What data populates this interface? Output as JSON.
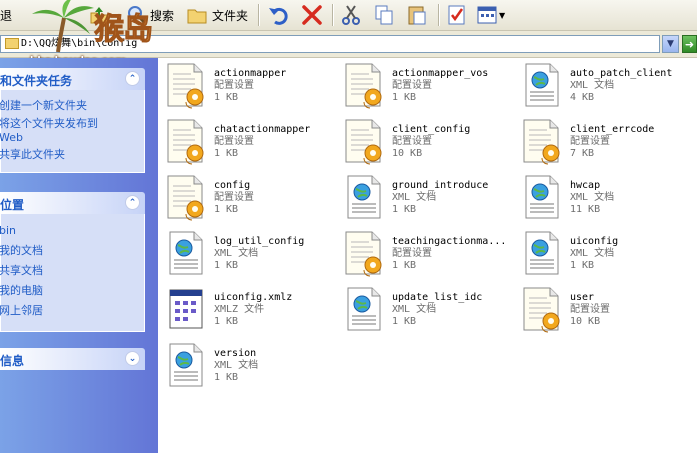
{
  "toolbar": {
    "back_label": "退",
    "search_label": "搜索",
    "folders_label": "文件夹"
  },
  "address": {
    "path": "D:\\QQ炫舞\\bin\\config"
  },
  "watermark": {
    "main": "猴岛",
    "sub": "bbs.houdao.com"
  },
  "sidebar": {
    "tasks_title": "和文件夹任务",
    "tasks": [
      "创建一个新文件夹",
      "将这个文件夹发布到",
      "Web",
      "共享此文件夹"
    ],
    "places_title": "位置",
    "places": [
      "bin",
      "我的文档",
      "共享文档",
      "我的电脑",
      "网上邻居"
    ],
    "details_title": "信息"
  },
  "files": [
    {
      "name": "actionmapper",
      "type": "配置设置",
      "size": "1 KB",
      "icon": "config-file-icon"
    },
    {
      "name": "actionmapper_vos",
      "type": "配置设置",
      "size": "1 KB",
      "icon": "config-file-icon"
    },
    {
      "name": "auto_patch_client",
      "type": "XML 文档",
      "size": "4 KB",
      "icon": "xml-file-icon"
    },
    {
      "name": "chatactionmapper",
      "type": "配置设置",
      "size": "1 KB",
      "icon": "config-file-icon"
    },
    {
      "name": "client_config",
      "type": "配置设置",
      "size": "10 KB",
      "icon": "config-file-icon"
    },
    {
      "name": "client_errcode",
      "type": "配置设置",
      "size": "7 KB",
      "icon": "config-file-icon"
    },
    {
      "name": "config",
      "type": "配置设置",
      "size": "1 KB",
      "icon": "config-file-icon"
    },
    {
      "name": "ground_introduce",
      "type": "XML 文档",
      "size": "1 KB",
      "icon": "xml-file-icon"
    },
    {
      "name": "hwcap",
      "type": "XML 文档",
      "size": "11 KB",
      "icon": "xml-file-icon"
    },
    {
      "name": "log_util_config",
      "type": "XML 文档",
      "size": "1 KB",
      "icon": "xml-file-icon"
    },
    {
      "name": "teachingactionma...",
      "type": "配置设置",
      "size": "1 KB",
      "icon": "config-file-icon"
    },
    {
      "name": "uiconfig",
      "type": "XML 文档",
      "size": "1 KB",
      "icon": "xml-file-icon"
    },
    {
      "name": "uiconfig.xmlz",
      "type": "XMLZ 文件",
      "size": "1 KB",
      "icon": "xmlz-file-icon"
    },
    {
      "name": "update_list_idc",
      "type": "XML 文档",
      "size": "1 KB",
      "icon": "xml-file-icon"
    },
    {
      "name": "user",
      "type": "配置设置",
      "size": "10 KB",
      "icon": "config-file-icon"
    },
    {
      "name": "version",
      "type": "XML 文档",
      "size": "1 KB",
      "icon": "xml-file-icon"
    }
  ],
  "colors": {
    "link_blue": "#215dc6",
    "pane_gradient_start": "#7ba2e7",
    "pane_gradient_end": "#6375d6"
  }
}
